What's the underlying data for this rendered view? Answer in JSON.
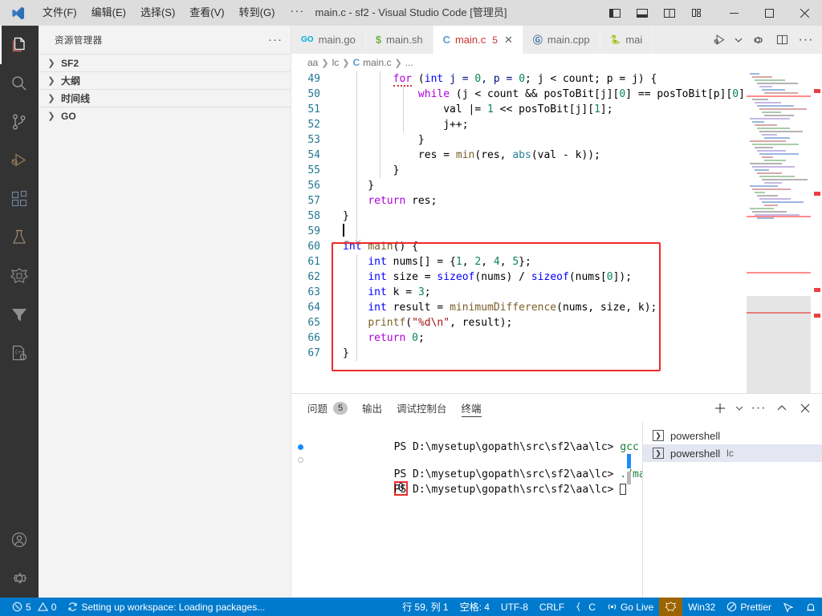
{
  "titlebar": {
    "logo_icon": "vscode-logo",
    "menus": [
      "文件(F)",
      "编辑(E)",
      "选择(S)",
      "查看(V)",
      "转到(G)"
    ],
    "overflow": "···",
    "title": "main.c - sf2 - Visual Studio Code [管理员]",
    "layout_icons": [
      "toggle-primary-sidebar-icon",
      "toggle-panel-icon",
      "toggle-secondary-sidebar-icon",
      "customize-layout-icon"
    ],
    "window_controls": [
      "minimize",
      "maximize",
      "close"
    ]
  },
  "activitybar": {
    "items": [
      {
        "name": "explorer",
        "icon": "files-icon",
        "active": true
      },
      {
        "name": "search",
        "icon": "search-icon",
        "active": false
      },
      {
        "name": "source-control",
        "icon": "source-control-icon",
        "active": false
      },
      {
        "name": "run-and-debug",
        "icon": "run-debug-icon",
        "active": false
      },
      {
        "name": "extensions",
        "icon": "extensions-icon",
        "active": false
      },
      {
        "name": "testing",
        "icon": "beaker-icon",
        "active": false
      },
      {
        "name": "go",
        "icon": "go-gopher-icon",
        "active": false
      },
      {
        "name": "filter",
        "icon": "funnel-icon",
        "active": false
      },
      {
        "name": "cpp-tools",
        "icon": "cpp-config-icon",
        "active": false
      }
    ],
    "bottom": [
      {
        "name": "accounts",
        "icon": "account-icon"
      },
      {
        "name": "manage",
        "icon": "gear-icon"
      }
    ]
  },
  "sidebar": {
    "title": "资源管理器",
    "more": "···",
    "sections": [
      {
        "label": "SF2",
        "expanded": false
      },
      {
        "label": "大纲",
        "expanded": false
      },
      {
        "label": "时间线",
        "expanded": false
      },
      {
        "label": "GO",
        "expanded": false
      }
    ]
  },
  "editor": {
    "tabs": [
      {
        "label": "main.go",
        "icon": "go-file-icon",
        "icon_glyph": "GO",
        "icon_color": "#00add8",
        "active": false,
        "badge": "",
        "close": false
      },
      {
        "label": "main.sh",
        "icon": "shell-file-icon",
        "icon_glyph": "$",
        "icon_color": "#6cb344",
        "active": false,
        "badge": "",
        "close": false
      },
      {
        "label": "main.c",
        "icon": "c-file-icon",
        "icon_glyph": "C",
        "icon_color": "#5a9bd5",
        "active": true,
        "badge": "5",
        "close": true
      },
      {
        "label": "main.cpp",
        "icon": "cpp-file-icon",
        "icon_glyph": "G+",
        "icon_color": "#4a79a4",
        "active": false,
        "badge": "",
        "close": false
      },
      {
        "label": "mai",
        "icon": "python-file-icon",
        "icon_glyph": "⬤",
        "icon_color": "#3572A5",
        "active": false,
        "badge": "",
        "close": false
      }
    ],
    "actions": [
      "run-or-debug-icon",
      "chevron-down-icon",
      "settings-gear-icon",
      "split-editor-icon",
      "more-actions-icon"
    ],
    "breadcrumbs": [
      "aa",
      "lc",
      "main.c",
      "..."
    ],
    "breadcrumb_file_icon": "C",
    "first_line_number": 49,
    "lines": [
      {
        "n": 49,
        "tokens": [
          {
            "t": "        ",
            "c": "op"
          },
          {
            "t": "for",
            "c": "kw2 squig"
          },
          {
            "t": " (",
            "c": "op"
          },
          {
            "t": "int",
            "c": "kw"
          },
          {
            "t": " j = ",
            "c": "var"
          },
          {
            "t": "0",
            "c": "num"
          },
          {
            "t": ", p = ",
            "c": "var"
          },
          {
            "t": "0",
            "c": "num"
          },
          {
            "t": "; j < count; p = j) {",
            "c": "op"
          }
        ]
      },
      {
        "n": 50,
        "tokens": [
          {
            "t": "            ",
            "c": "op"
          },
          {
            "t": "while",
            "c": "kw2"
          },
          {
            "t": " (j < count && posToBit[j][",
            "c": "op"
          },
          {
            "t": "0",
            "c": "num"
          },
          {
            "t": "] == posToBit[p][",
            "c": "op"
          },
          {
            "t": "0",
            "c": "num"
          },
          {
            "t": "])",
            "c": "op"
          }
        ]
      },
      {
        "n": 51,
        "tokens": [
          {
            "t": "                val |= ",
            "c": "op"
          },
          {
            "t": "1",
            "c": "num"
          },
          {
            "t": " << posToBit[j][",
            "c": "op"
          },
          {
            "t": "1",
            "c": "num"
          },
          {
            "t": "];",
            "c": "op"
          }
        ]
      },
      {
        "n": 52,
        "tokens": [
          {
            "t": "                j++;",
            "c": "op"
          }
        ]
      },
      {
        "n": 53,
        "tokens": [
          {
            "t": "            }",
            "c": "op"
          }
        ]
      },
      {
        "n": 54,
        "tokens": [
          {
            "t": "            res = ",
            "c": "op"
          },
          {
            "t": "min",
            "c": "fn"
          },
          {
            "t": "(res, ",
            "c": "op"
          },
          {
            "t": "abs",
            "c": "typ"
          },
          {
            "t": "(val - k));",
            "c": "op"
          }
        ]
      },
      {
        "n": 55,
        "tokens": [
          {
            "t": "        }",
            "c": "op"
          }
        ]
      },
      {
        "n": 56,
        "tokens": [
          {
            "t": "    }",
            "c": "op"
          }
        ]
      },
      {
        "n": 57,
        "tokens": [
          {
            "t": "    ",
            "c": "op"
          },
          {
            "t": "return",
            "c": "kw2"
          },
          {
            "t": " res;",
            "c": "op"
          }
        ]
      },
      {
        "n": 58,
        "tokens": [
          {
            "t": "}",
            "c": "op"
          }
        ]
      },
      {
        "n": 59,
        "tokens": []
      },
      {
        "n": 60,
        "tokens": [
          {
            "t": "int",
            "c": "kw"
          },
          {
            "t": " ",
            "c": "op"
          },
          {
            "t": "main",
            "c": "fn"
          },
          {
            "t": "() {",
            "c": "op"
          }
        ]
      },
      {
        "n": 61,
        "tokens": [
          {
            "t": "    ",
            "c": "op"
          },
          {
            "t": "int",
            "c": "kw"
          },
          {
            "t": " nums[] = {",
            "c": "op"
          },
          {
            "t": "1",
            "c": "num"
          },
          {
            "t": ", ",
            "c": "op"
          },
          {
            "t": "2",
            "c": "num"
          },
          {
            "t": ", ",
            "c": "op"
          },
          {
            "t": "4",
            "c": "num"
          },
          {
            "t": ", ",
            "c": "op"
          },
          {
            "t": "5",
            "c": "num"
          },
          {
            "t": "};",
            "c": "op"
          }
        ]
      },
      {
        "n": 62,
        "tokens": [
          {
            "t": "    ",
            "c": "op"
          },
          {
            "t": "int",
            "c": "kw"
          },
          {
            "t": " size = ",
            "c": "op"
          },
          {
            "t": "sizeof",
            "c": "kw"
          },
          {
            "t": "(nums) / ",
            "c": "op"
          },
          {
            "t": "sizeof",
            "c": "kw"
          },
          {
            "t": "(nums[",
            "c": "op"
          },
          {
            "t": "0",
            "c": "num"
          },
          {
            "t": "]);",
            "c": "op"
          }
        ]
      },
      {
        "n": 63,
        "tokens": [
          {
            "t": "    ",
            "c": "op"
          },
          {
            "t": "int",
            "c": "kw"
          },
          {
            "t": " k = ",
            "c": "op"
          },
          {
            "t": "3",
            "c": "num"
          },
          {
            "t": ";",
            "c": "op"
          }
        ]
      },
      {
        "n": 64,
        "tokens": [
          {
            "t": "    ",
            "c": "op"
          },
          {
            "t": "int",
            "c": "kw"
          },
          {
            "t": " result = ",
            "c": "op"
          },
          {
            "t": "minimumDifference",
            "c": "fn"
          },
          {
            "t": "(nums, size, k);",
            "c": "op"
          }
        ]
      },
      {
        "n": 65,
        "tokens": [
          {
            "t": "    ",
            "c": "op"
          },
          {
            "t": "printf",
            "c": "fn"
          },
          {
            "t": "(",
            "c": "op"
          },
          {
            "t": "\"%d\\n\"",
            "c": "str"
          },
          {
            "t": ", result);",
            "c": "op"
          }
        ]
      },
      {
        "n": 66,
        "tokens": [
          {
            "t": "    ",
            "c": "op"
          },
          {
            "t": "return",
            "c": "kw2"
          },
          {
            "t": " ",
            "c": "op"
          },
          {
            "t": "0",
            "c": "num"
          },
          {
            "t": ";",
            "c": "op"
          }
        ]
      },
      {
        "n": 67,
        "tokens": [
          {
            "t": "}",
            "c": "op"
          }
        ]
      }
    ],
    "highlight_box_color": "#ee2b2b",
    "highlight_box_label": "main-function-highlight"
  },
  "panel": {
    "tabs": [
      {
        "label": "问题",
        "badge": "5",
        "active": false
      },
      {
        "label": "输出",
        "badge": "",
        "active": false
      },
      {
        "label": "调试控制台",
        "badge": "",
        "active": false
      },
      {
        "label": "终端",
        "badge": "",
        "active": true
      }
    ],
    "actions": [
      "new-terminal-icon",
      "chevron-down-icon",
      "more-actions-icon",
      "maximize-panel-icon",
      "close-panel-icon"
    ],
    "terminal_lines": [
      {
        "prompt": "PS D:\\mysetup\\gopath\\src\\sf2\\aa\\lc>",
        "command": " gcc main.c -o main",
        "marker": "none"
      },
      {
        "prompt": "PS D:\\mysetup\\gopath\\src\\sf2\\aa\\lc>",
        "command": " ./main.exe",
        "marker": "filled"
      },
      {
        "prompt": "",
        "command": "0",
        "marker": "hollow",
        "boxed": true
      },
      {
        "prompt": "PS D:\\mysetup\\gopath\\src\\sf2\\aa\\lc>",
        "command": " ",
        "marker": "none",
        "caret": true
      }
    ],
    "terminal_list": [
      {
        "label": "powershell",
        "sub": "",
        "icon": "terminal-icon",
        "active": false
      },
      {
        "label": "powershell",
        "sub": "lc",
        "icon": "terminal-icon",
        "active": true
      }
    ]
  },
  "statusbar": {
    "left": [
      {
        "name": "problems",
        "icon": "error-icon",
        "text": "5",
        "icon2": "warning-icon",
        "text2": "0"
      },
      {
        "name": "workspace-status",
        "icon": "sync-icon",
        "text": "Setting up workspace: Loading packages..."
      }
    ],
    "right": [
      {
        "name": "cursor-position",
        "text": "行 59, 列 1"
      },
      {
        "name": "indentation",
        "text": "空格: 4"
      },
      {
        "name": "encoding",
        "text": "UTF-8"
      },
      {
        "name": "eol",
        "text": "CRLF"
      },
      {
        "name": "language-mode",
        "text": "C",
        "icon": "braces-icon"
      },
      {
        "name": "go-live",
        "text": "Go Live",
        "icon": "broadcast-icon"
      },
      {
        "name": "go-gopher",
        "text": "",
        "icon": "gopher-icon",
        "highlight": true
      },
      {
        "name": "platform",
        "text": "Win32"
      },
      {
        "name": "prettier",
        "text": "Prettier",
        "icon": "prohibited-icon"
      },
      {
        "name": "feedback",
        "text": "",
        "icon": "feedback-icon"
      },
      {
        "name": "notifications",
        "text": "",
        "icon": "bell-icon"
      }
    ]
  },
  "colors": {
    "accent": "#007acc",
    "titlebar_bg": "#dddddd",
    "activitybar_bg": "#333333",
    "sidebar_bg": "#f3f3f3",
    "tab_inactive_bg": "#ececec",
    "error_red": "#cd3131",
    "highlight_box": "#ee2b2b",
    "go_highlight": "#9c6400"
  }
}
